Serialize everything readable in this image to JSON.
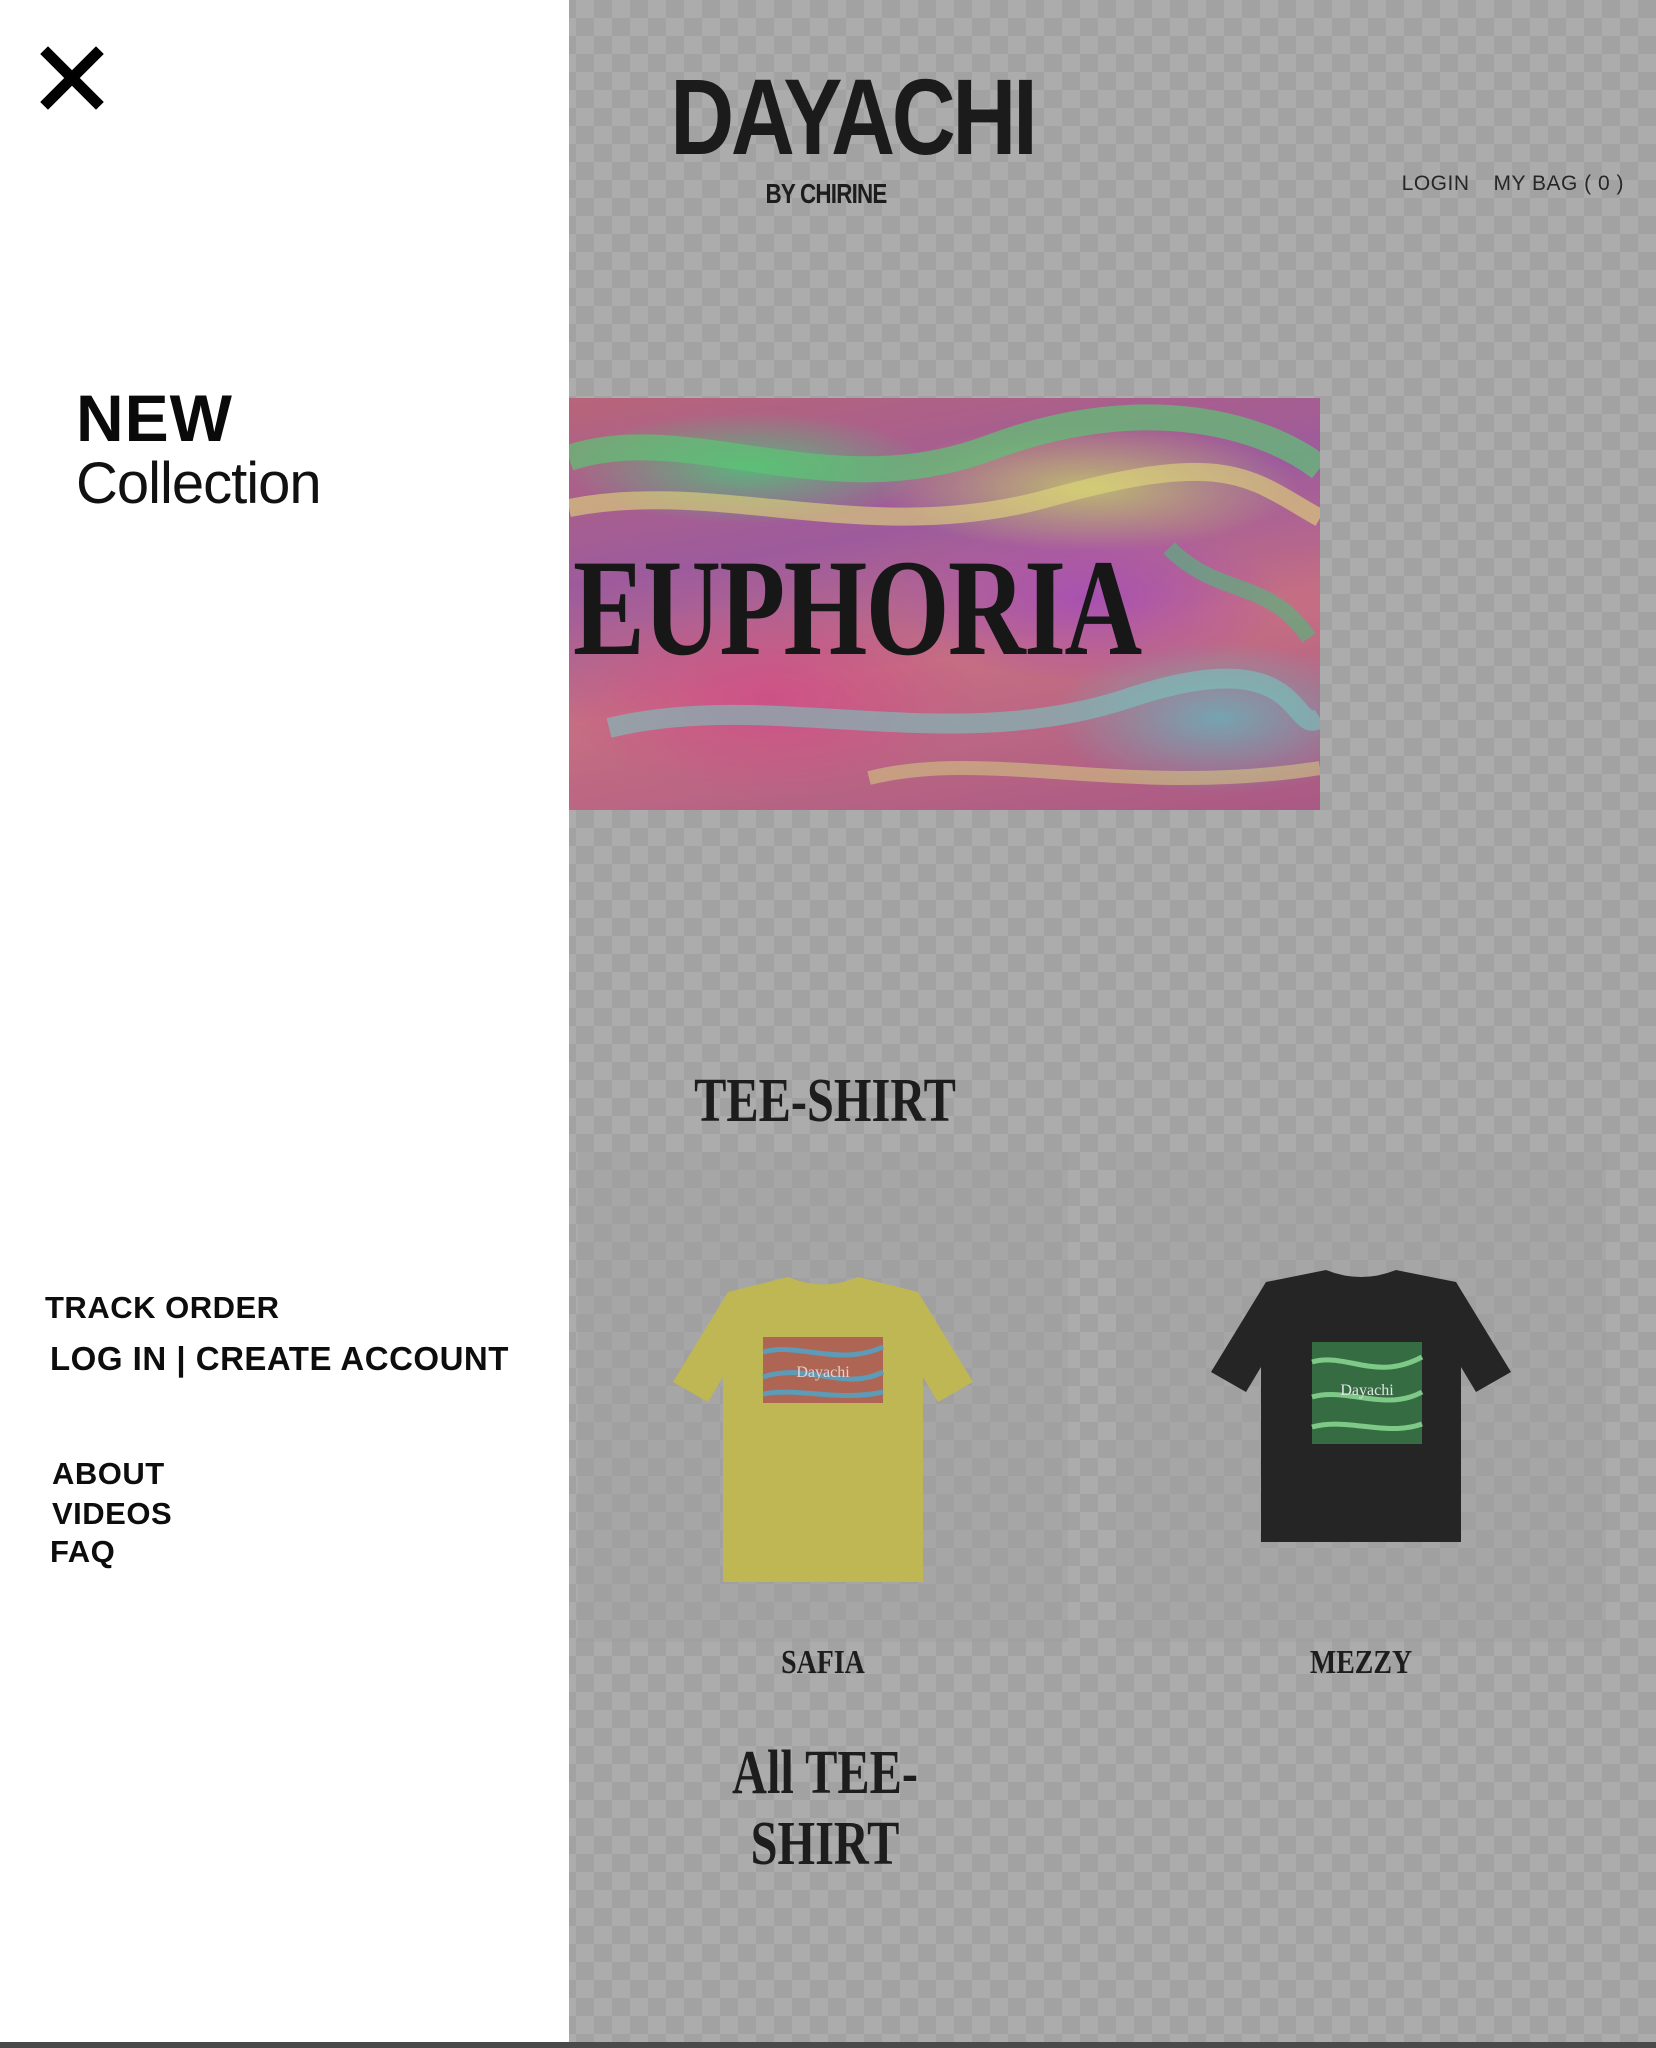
{
  "brand": {
    "name": "DAYACHI",
    "sub": "BY CHIRINE"
  },
  "topnav": {
    "login": "LOGIN",
    "bag": "MY BAG ( 0 )"
  },
  "banner": {
    "text": "EUPHORIA"
  },
  "sections": {
    "tee": "TEE-SHIRT",
    "all": "All TEE-SHIRT"
  },
  "products": [
    {
      "name": "SAFIA",
      "color": "#c9c04f",
      "print": "Dayachi"
    },
    {
      "name": "MEZZY",
      "color": "#1a1a1a",
      "print": "Dayachi"
    }
  ],
  "drawer": {
    "new_title": "NEW",
    "new_sub": "Collection",
    "track": "TRACK ORDER",
    "account": "LOG IN | CREATE ACCOUNT",
    "about": "ABOUT",
    "videos": "VIDEOS",
    "faq": "FAQ"
  },
  "icons": {
    "close": "close-icon"
  }
}
